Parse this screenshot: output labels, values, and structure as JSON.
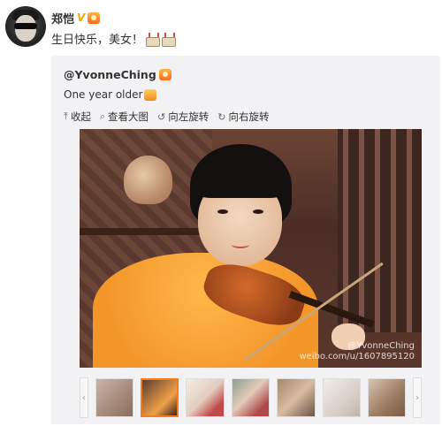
{
  "post": {
    "author": "郑恺",
    "verified_badge": "V",
    "text": "生日快乐，美女！",
    "emoji_icons": [
      "cake-icon",
      "cake-icon"
    ]
  },
  "repost": {
    "author": "@YvonneChing",
    "text": "One year older",
    "toolbar": {
      "collapse": "收起",
      "view_large": "查看大图",
      "rotate_left": "向左旋转",
      "rotate_right": "向右旋转"
    },
    "photo": {
      "watermark_line1": "@YvonneChing",
      "watermark_line2": "weibo.com/u/1607895120"
    },
    "thumbnails": {
      "count": 7,
      "selected_index": 1
    }
  },
  "colors": {
    "accent": "#f77c1a",
    "repost_bg": "#f2f2f5",
    "verified": "#f5a700"
  }
}
